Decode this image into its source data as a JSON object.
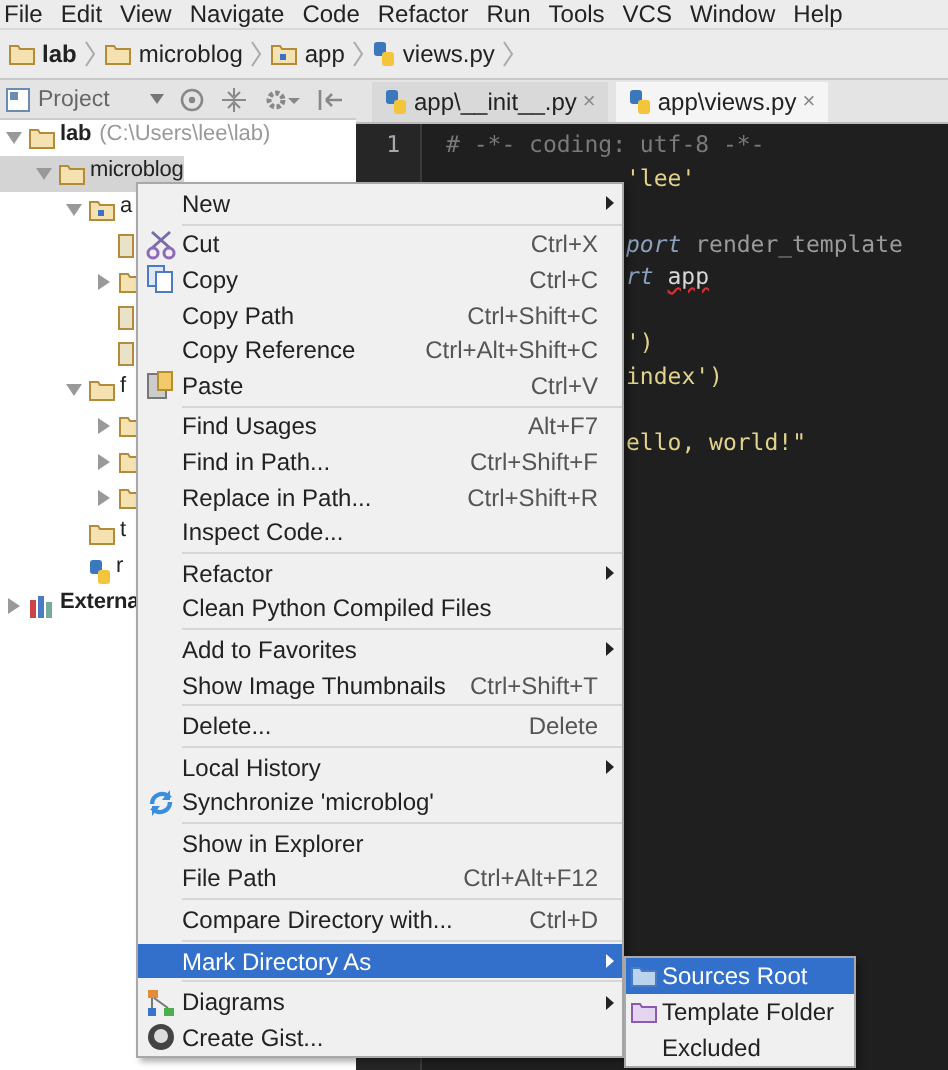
{
  "menubar": [
    {
      "label": "File"
    },
    {
      "label": "Edit"
    },
    {
      "label": "View"
    },
    {
      "label": "Navigate"
    },
    {
      "label": "Code"
    },
    {
      "label": "Refactor"
    },
    {
      "label": "Run"
    },
    {
      "label": "Tools"
    },
    {
      "label": "VCS"
    },
    {
      "label": "Window"
    },
    {
      "label": "Help"
    }
  ],
  "breadcrumbs": [
    {
      "label": "lab",
      "kind": "folder",
      "bold": true
    },
    {
      "label": "microblog",
      "kind": "folder",
      "bold": false
    },
    {
      "label": "app",
      "kind": "module",
      "bold": false
    },
    {
      "label": "views.py",
      "kind": "python",
      "bold": false
    }
  ],
  "project_panel": {
    "title": "Project"
  },
  "tabs": [
    {
      "label": "app\\__init__.py",
      "close": "×",
      "selected": false
    },
    {
      "label": "app\\views.py",
      "close": "×",
      "selected": true
    }
  ],
  "tree": [
    {
      "label": "lab",
      "path": "(C:\\Users\\lee\\lab)",
      "kind": "folder",
      "expanded": true,
      "selected": false,
      "children": [
        {
          "label": "microblog",
          "kind": "folder",
          "expanded": true,
          "selected": true,
          "children": [
            {
              "label": "a",
              "kind": "module",
              "expanded": true,
              "selected": false,
              "children": [
                {
                  "kind": "file",
                  "selected": false
                },
                {
                  "kind": "folder",
                  "expanded": false,
                  "selected": false
                },
                {
                  "kind": "file",
                  "selected": false
                },
                {
                  "kind": "file",
                  "selected": false
                }
              ]
            },
            {
              "label": "f",
              "kind": "folder",
              "expanded": true,
              "selected": false,
              "children": [
                {
                  "kind": "folder",
                  "expanded": false,
                  "selected": false
                },
                {
                  "kind": "folder",
                  "expanded": false,
                  "selected": false
                },
                {
                  "kind": "folder",
                  "expanded": false,
                  "selected": false
                }
              ]
            },
            {
              "label": "t",
              "kind": "folder",
              "selected": false
            },
            {
              "label": "r",
              "kind": "python",
              "selected": false
            }
          ]
        }
      ]
    },
    {
      "label": "Externa",
      "kind": "library",
      "expanded": false,
      "selected": false
    }
  ],
  "editor": {
    "line_numbers": [
      "1"
    ],
    "lines": [
      {
        "kind": "full",
        "segments": [
          {
            "text": "# -*- coding: utf-8 -*-",
            "kind": "comment"
          }
        ]
      },
      {
        "kind": "partial",
        "segments": [
          {
            "text": "'lee'",
            "kind": "string"
          }
        ]
      },
      {
        "kind": "blank"
      },
      {
        "kind": "partial",
        "segments": [
          {
            "text": "port",
            "kind": "keyword"
          },
          {
            "text": "render_template",
            "kind": "plain"
          }
        ]
      },
      {
        "kind": "partial",
        "segments": [
          {
            "text": "rt",
            "kind": "keyword"
          },
          {
            "text": "app",
            "kind": "warning"
          }
        ]
      },
      {
        "kind": "blank"
      },
      {
        "kind": "partial",
        "segments": [
          {
            "text": "')",
            "kind": "string"
          }
        ]
      },
      {
        "kind": "partial",
        "segments": [
          {
            "text": "index')",
            "kind": "string"
          }
        ]
      },
      {
        "kind": "blank"
      },
      {
        "kind": "partial",
        "segments": [
          {
            "text": "ello, world!\"",
            "kind": "string"
          }
        ]
      }
    ]
  },
  "context_menu": {
    "groups": [
      [
        {
          "label": "New",
          "kind": "plain",
          "submenu": true,
          "selected": false
        }
      ],
      [
        {
          "label": "Cut",
          "kind": "cut",
          "shortcut": "Ctrl+X",
          "selected": false
        },
        {
          "label": "Copy",
          "kind": "copy",
          "shortcut": "Ctrl+C",
          "selected": false
        },
        {
          "label": "Copy Path",
          "kind": "plain",
          "shortcut": "Ctrl+Shift+C",
          "selected": false
        },
        {
          "label": "Copy Reference",
          "kind": "plain",
          "shortcut": "Ctrl+Alt+Shift+C",
          "selected": false
        },
        {
          "label": "Paste",
          "kind": "paste",
          "shortcut": "Ctrl+V",
          "selected": false
        }
      ],
      [
        {
          "label": "Find Usages",
          "kind": "plain",
          "shortcut": "Alt+F7",
          "selected": false
        },
        {
          "label": "Find in Path...",
          "kind": "plain",
          "shortcut": "Ctrl+Shift+F",
          "selected": false
        },
        {
          "label": "Replace in Path...",
          "kind": "plain",
          "shortcut": "Ctrl+Shift+R",
          "selected": false
        },
        {
          "label": "Inspect Code...",
          "kind": "plain",
          "selected": false
        }
      ],
      [
        {
          "label": "Refactor",
          "kind": "plain",
          "submenu": true,
          "selected": false
        },
        {
          "label": "Clean Python Compiled Files",
          "kind": "plain",
          "selected": false
        }
      ],
      [
        {
          "label": "Add to Favorites",
          "kind": "plain",
          "submenu": true,
          "selected": false
        },
        {
          "label": "Show Image Thumbnails",
          "kind": "plain",
          "shortcut": "Ctrl+Shift+T",
          "selected": false
        }
      ],
      [
        {
          "label": "Delete...",
          "kind": "plain",
          "shortcut": "Delete",
          "selected": false
        }
      ],
      [
        {
          "label": "Local History",
          "kind": "plain",
          "submenu": true,
          "selected": false
        },
        {
          "label": "Synchronize 'microblog'",
          "kind": "sync",
          "selected": false
        }
      ],
      [
        {
          "label": "Show in Explorer",
          "kind": "plain",
          "selected": false
        },
        {
          "label": "File Path",
          "kind": "plain",
          "shortcut": "Ctrl+Alt+F12",
          "selected": false
        }
      ],
      [
        {
          "label": "Compare Directory with...",
          "kind": "plain",
          "shortcut": "Ctrl+D",
          "selected": false
        }
      ],
      [
        {
          "label": "Mark Directory As",
          "kind": "plain",
          "submenu": true,
          "selected": true
        }
      ],
      [
        {
          "label": "Diagrams",
          "kind": "diagrams",
          "submenu": true,
          "selected": false
        },
        {
          "label": "Create Gist...",
          "kind": "gist",
          "selected": false
        }
      ]
    ]
  },
  "submenu": [
    {
      "label": "Sources Root",
      "kind": "source-folder",
      "selected": true
    },
    {
      "label": "Template Folder",
      "kind": "template-folder",
      "selected": false
    },
    {
      "label": "Excluded",
      "kind": "plain",
      "selected": false
    }
  ]
}
